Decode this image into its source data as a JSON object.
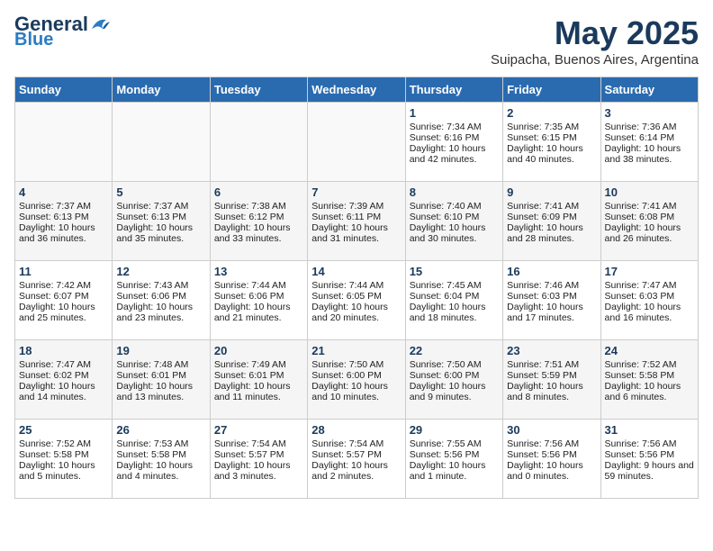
{
  "header": {
    "logo_line1": "General",
    "logo_line2": "Blue",
    "month": "May 2025",
    "location": "Suipacha, Buenos Aires, Argentina"
  },
  "days_of_week": [
    "Sunday",
    "Monday",
    "Tuesday",
    "Wednesday",
    "Thursday",
    "Friday",
    "Saturday"
  ],
  "weeks": [
    [
      {
        "day": "",
        "content": ""
      },
      {
        "day": "",
        "content": ""
      },
      {
        "day": "",
        "content": ""
      },
      {
        "day": "",
        "content": ""
      },
      {
        "day": "1",
        "content": "Sunrise: 7:34 AM\nSunset: 6:16 PM\nDaylight: 10 hours and 42 minutes."
      },
      {
        "day": "2",
        "content": "Sunrise: 7:35 AM\nSunset: 6:15 PM\nDaylight: 10 hours and 40 minutes."
      },
      {
        "day": "3",
        "content": "Sunrise: 7:36 AM\nSunset: 6:14 PM\nDaylight: 10 hours and 38 minutes."
      }
    ],
    [
      {
        "day": "4",
        "content": "Sunrise: 7:37 AM\nSunset: 6:13 PM\nDaylight: 10 hours and 36 minutes."
      },
      {
        "day": "5",
        "content": "Sunrise: 7:37 AM\nSunset: 6:13 PM\nDaylight: 10 hours and 35 minutes."
      },
      {
        "day": "6",
        "content": "Sunrise: 7:38 AM\nSunset: 6:12 PM\nDaylight: 10 hours and 33 minutes."
      },
      {
        "day": "7",
        "content": "Sunrise: 7:39 AM\nSunset: 6:11 PM\nDaylight: 10 hours and 31 minutes."
      },
      {
        "day": "8",
        "content": "Sunrise: 7:40 AM\nSunset: 6:10 PM\nDaylight: 10 hours and 30 minutes."
      },
      {
        "day": "9",
        "content": "Sunrise: 7:41 AM\nSunset: 6:09 PM\nDaylight: 10 hours and 28 minutes."
      },
      {
        "day": "10",
        "content": "Sunrise: 7:41 AM\nSunset: 6:08 PM\nDaylight: 10 hours and 26 minutes."
      }
    ],
    [
      {
        "day": "11",
        "content": "Sunrise: 7:42 AM\nSunset: 6:07 PM\nDaylight: 10 hours and 25 minutes."
      },
      {
        "day": "12",
        "content": "Sunrise: 7:43 AM\nSunset: 6:06 PM\nDaylight: 10 hours and 23 minutes."
      },
      {
        "day": "13",
        "content": "Sunrise: 7:44 AM\nSunset: 6:06 PM\nDaylight: 10 hours and 21 minutes."
      },
      {
        "day": "14",
        "content": "Sunrise: 7:44 AM\nSunset: 6:05 PM\nDaylight: 10 hours and 20 minutes."
      },
      {
        "day": "15",
        "content": "Sunrise: 7:45 AM\nSunset: 6:04 PM\nDaylight: 10 hours and 18 minutes."
      },
      {
        "day": "16",
        "content": "Sunrise: 7:46 AM\nSunset: 6:03 PM\nDaylight: 10 hours and 17 minutes."
      },
      {
        "day": "17",
        "content": "Sunrise: 7:47 AM\nSunset: 6:03 PM\nDaylight: 10 hours and 16 minutes."
      }
    ],
    [
      {
        "day": "18",
        "content": "Sunrise: 7:47 AM\nSunset: 6:02 PM\nDaylight: 10 hours and 14 minutes."
      },
      {
        "day": "19",
        "content": "Sunrise: 7:48 AM\nSunset: 6:01 PM\nDaylight: 10 hours and 13 minutes."
      },
      {
        "day": "20",
        "content": "Sunrise: 7:49 AM\nSunset: 6:01 PM\nDaylight: 10 hours and 11 minutes."
      },
      {
        "day": "21",
        "content": "Sunrise: 7:50 AM\nSunset: 6:00 PM\nDaylight: 10 hours and 10 minutes."
      },
      {
        "day": "22",
        "content": "Sunrise: 7:50 AM\nSunset: 6:00 PM\nDaylight: 10 hours and 9 minutes."
      },
      {
        "day": "23",
        "content": "Sunrise: 7:51 AM\nSunset: 5:59 PM\nDaylight: 10 hours and 8 minutes."
      },
      {
        "day": "24",
        "content": "Sunrise: 7:52 AM\nSunset: 5:58 PM\nDaylight: 10 hours and 6 minutes."
      }
    ],
    [
      {
        "day": "25",
        "content": "Sunrise: 7:52 AM\nSunset: 5:58 PM\nDaylight: 10 hours and 5 minutes."
      },
      {
        "day": "26",
        "content": "Sunrise: 7:53 AM\nSunset: 5:58 PM\nDaylight: 10 hours and 4 minutes."
      },
      {
        "day": "27",
        "content": "Sunrise: 7:54 AM\nSunset: 5:57 PM\nDaylight: 10 hours and 3 minutes."
      },
      {
        "day": "28",
        "content": "Sunrise: 7:54 AM\nSunset: 5:57 PM\nDaylight: 10 hours and 2 minutes."
      },
      {
        "day": "29",
        "content": "Sunrise: 7:55 AM\nSunset: 5:56 PM\nDaylight: 10 hours and 1 minute."
      },
      {
        "day": "30",
        "content": "Sunrise: 7:56 AM\nSunset: 5:56 PM\nDaylight: 10 hours and 0 minutes."
      },
      {
        "day": "31",
        "content": "Sunrise: 7:56 AM\nSunset: 5:56 PM\nDaylight: 9 hours and 59 minutes."
      }
    ]
  ]
}
